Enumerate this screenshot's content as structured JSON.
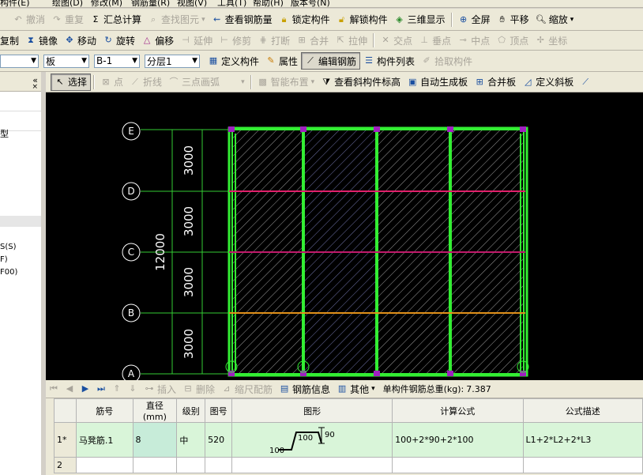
{
  "menu": [
    "构件(E)",
    "绘图(D)",
    "修改(M)",
    "钢筋量(R)",
    "视图(V)",
    "工具(T)",
    "帮助(H)",
    "版本号(N)"
  ],
  "toolbar1": {
    "undo": "撤消",
    "redo": "重复",
    "sum": "汇总计算",
    "find": "查找图元",
    "view_rebar": "查看钢筋量",
    "lock": "锁定构件",
    "unlock": "解锁构件",
    "view3d": "三维显示",
    "fullscreen": "全屏",
    "pan": "平移",
    "zoom": "缩放"
  },
  "toolbar2": {
    "copy": "复制",
    "mirror": "镜像",
    "move": "移动",
    "rotate": "旋转",
    "offset": "偏移",
    "extend": "延伸",
    "trim": "修剪",
    "break": "打断",
    "merge": "合并",
    "stretch": "拉伸",
    "intersect": "交点",
    "perp": "垂点",
    "mid": "中点",
    "vertex": "顶点",
    "coord": "坐标"
  },
  "toolbar3": {
    "type_value": "板",
    "name_value": "B-1",
    "floor_value": "分层1",
    "define": "定义构件",
    "props": "属性",
    "edit_rebar": "编辑钢筋",
    "list": "构件列表",
    "pick": "拾取构件"
  },
  "toolbar4": {
    "select": "选择",
    "point": "点",
    "polyline": "折线",
    "arc": "三点画弧",
    "smart": "智能布置",
    "view_slope": "查看斜构件标高",
    "auto_slab": "自动生成板",
    "merge_slab": "合并板",
    "define_slope": "定义斜板"
  },
  "left_panel": {
    "item1": "型",
    "item2": "S(S)",
    "item3": "F)",
    "item4": "F00)"
  },
  "drawing": {
    "axes": [
      "E",
      "D",
      "C",
      "B",
      "A"
    ],
    "spans": [
      "3000",
      "3000",
      "3000",
      "3000"
    ],
    "total": "12000"
  },
  "bottom_toolbar": {
    "insert": "插入",
    "delete": "删除",
    "scale": "缩尺配筋",
    "rebar_info": "钢筋信息",
    "other": "其他",
    "total_label": "单构件钢筋总重(kg):",
    "total_value": "7.387"
  },
  "table": {
    "headers": [
      "筋号",
      "直径(mm)",
      "级别",
      "图号",
      "图形",
      "计算公式",
      "公式描述"
    ],
    "rows": [
      {
        "idx": "1*",
        "name": "马凳筋.1",
        "dia": "8",
        "grade": "中",
        "fig": "520",
        "formula": "100+2*90+2*100",
        "desc": "L1+2*L2+2*L3",
        "shape": {
          "a": "100",
          "b": "100",
          "c": "90"
        }
      },
      {
        "idx": "2",
        "name": "",
        "dia": "",
        "grade": "",
        "fig": "",
        "formula": "",
        "desc": ""
      }
    ]
  }
}
